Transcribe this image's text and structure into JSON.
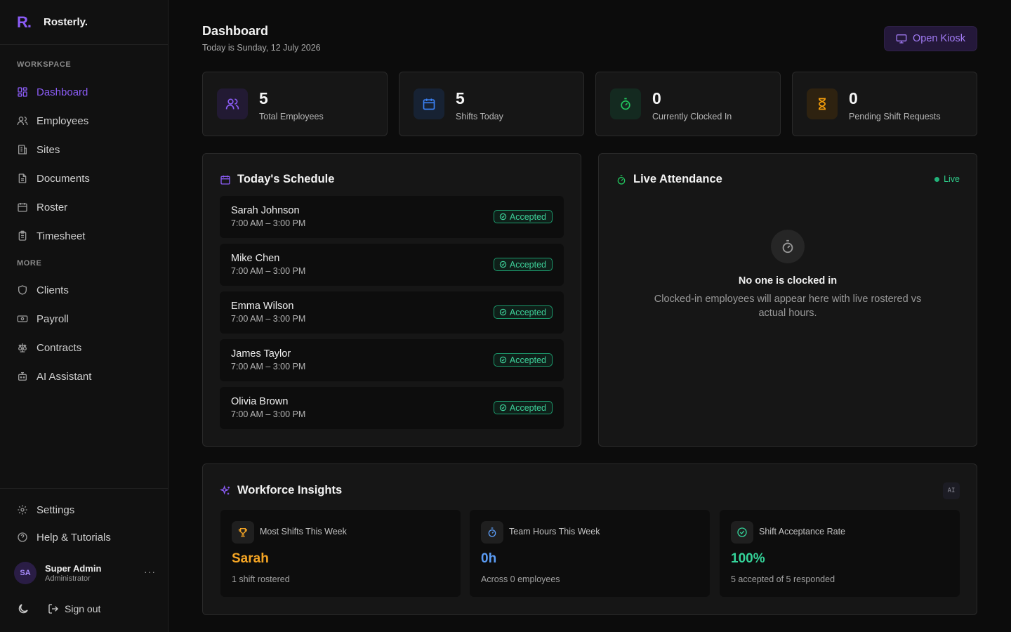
{
  "brand": {
    "logo": "R.",
    "name": "Rosterly."
  },
  "sidebar": {
    "workspace_label": "WORKSPACE",
    "more_label": "MORE",
    "workspace_items": [
      {
        "label": "Dashboard",
        "icon": "dashboard-icon",
        "active": true
      },
      {
        "label": "Employees",
        "icon": "users-icon"
      },
      {
        "label": "Sites",
        "icon": "building-icon"
      },
      {
        "label": "Documents",
        "icon": "document-icon"
      },
      {
        "label": "Roster",
        "icon": "calendar-icon"
      },
      {
        "label": "Timesheet",
        "icon": "clipboard-icon"
      }
    ],
    "more_items": [
      {
        "label": "Clients",
        "icon": "shield-icon"
      },
      {
        "label": "Payroll",
        "icon": "banknote-icon"
      },
      {
        "label": "Contracts",
        "icon": "scale-icon"
      },
      {
        "label": "AI Assistant",
        "icon": "bot-icon"
      }
    ],
    "settings_label": "Settings",
    "help_label": "Help & Tutorials",
    "user": {
      "initials": "SA",
      "name": "Super Admin",
      "role": "Administrator",
      "more": "···"
    },
    "signout_label": "Sign out"
  },
  "header": {
    "title": "Dashboard",
    "subtitle": "Today is Sunday, 12 July 2026",
    "kiosk_label": "Open Kiosk"
  },
  "stats": [
    {
      "value": "5",
      "label": "Total Employees",
      "icon": "users-icon",
      "color": "#8b5cf6",
      "bg": "#221a33"
    },
    {
      "value": "5",
      "label": "Shifts Today",
      "icon": "calendar-icon",
      "color": "#3b82f6",
      "bg": "#172233"
    },
    {
      "value": "0",
      "label": "Currently Clocked In",
      "icon": "stopwatch-icon",
      "color": "#22c55e",
      "bg": "#142a20"
    },
    {
      "value": "0",
      "label": "Pending Shift Requests",
      "icon": "hourglass-icon",
      "color": "#f59e0b",
      "bg": "#2e2210"
    }
  ],
  "schedule": {
    "title": "Today's Schedule",
    "rows": [
      {
        "name": "Sarah Johnson",
        "time": "7:00 AM – 3:00 PM",
        "status": "Accepted"
      },
      {
        "name": "Mike Chen",
        "time": "7:00 AM – 3:00 PM",
        "status": "Accepted"
      },
      {
        "name": "Emma Wilson",
        "time": "7:00 AM – 3:00 PM",
        "status": "Accepted"
      },
      {
        "name": "James Taylor",
        "time": "7:00 AM – 3:00 PM",
        "status": "Accepted"
      },
      {
        "name": "Olivia Brown",
        "time": "7:00 AM – 3:00 PM",
        "status": "Accepted"
      }
    ]
  },
  "attendance": {
    "title": "Live Attendance",
    "live_label": "Live",
    "empty_title": "No one is clocked in",
    "empty_desc": "Clocked-in employees will appear here with live rostered vs actual hours."
  },
  "insights": {
    "title": "Workforce Insights",
    "ai_tag": "AI",
    "cards": [
      {
        "label": "Most Shifts This Week",
        "value": "Sarah",
        "sub": "1 shift rostered",
        "icon": "trophy-icon",
        "color": "#f5a524"
      },
      {
        "label": "Team Hours This Week",
        "value": "0h",
        "sub": "Across 0 employees",
        "icon": "stopwatch-icon",
        "color": "#5b9cf5"
      },
      {
        "label": "Shift Acceptance Rate",
        "value": "100%",
        "sub": "5 accepted of 5 responded",
        "icon": "check-circle-icon",
        "color": "#34d399"
      }
    ]
  }
}
